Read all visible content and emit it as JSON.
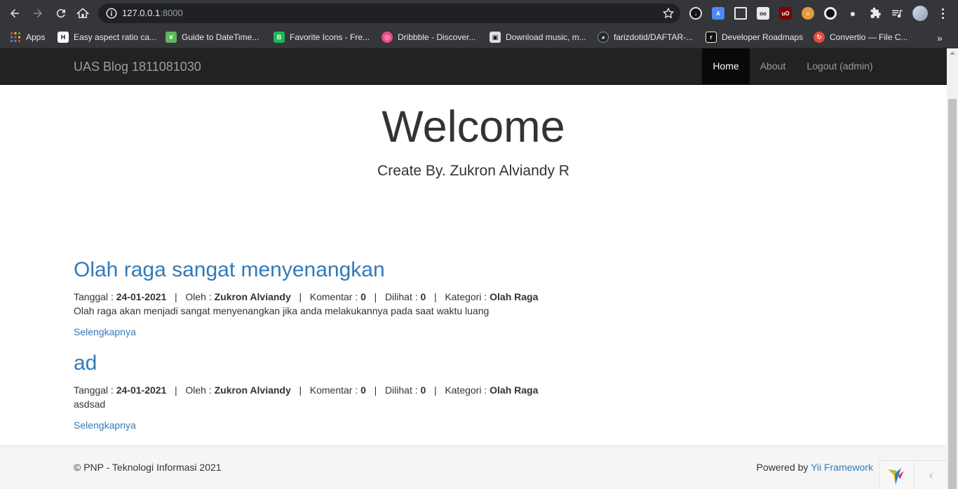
{
  "browser": {
    "url_host": "127.0.0.1",
    "url_port": ":8000",
    "bookmarks": [
      {
        "label": "Apps",
        "icon": "apps-grid-icon",
        "color": "#4285f4"
      },
      {
        "label": "Easy aspect ratio ca...",
        "icon": "aspect-ratio-icon",
        "color": "#ffffff"
      },
      {
        "label": "Guide to DateTime...",
        "icon": "leaf-icon",
        "color": "#5cb85c"
      },
      {
        "label": "Favorite Icons - Fre...",
        "icon": "favorite-icons-icon",
        "color": "#1db954"
      },
      {
        "label": "Dribbble - Discover...",
        "icon": "dribbble-icon",
        "color": "#ea4c89"
      },
      {
        "label": "Download music, m...",
        "icon": "music-download-icon",
        "color": "#dddddd"
      },
      {
        "label": "farizdotid/DAFTAR-...",
        "icon": "github-icon",
        "color": "#24292e"
      },
      {
        "label": "Developer Roadmaps",
        "icon": "roadmap-icon",
        "color": "#111111"
      },
      {
        "label": "Convertio — File C...",
        "icon": "convertio-icon",
        "color": "#e74c3c"
      }
    ]
  },
  "navbar": {
    "brand": "UAS Blog 1811081030",
    "items": [
      {
        "label": "Home",
        "active": true
      },
      {
        "label": "About",
        "active": false
      },
      {
        "label": "Logout (admin)",
        "active": false
      }
    ]
  },
  "jumbotron": {
    "title": "Welcome",
    "subtitle": "Create By. Zukron Alviandy R"
  },
  "posts": [
    {
      "title": "Olah raga sangat menyenangkan",
      "tanggal_label": "Tanggal :",
      "tanggal": "24-01-2021",
      "oleh_label": "Oleh :",
      "oleh": "Zukron Alviandy",
      "komentar_label": "Komentar :",
      "komentar": "0",
      "dilihat_label": "Dilihat :",
      "dilihat": "0",
      "kategori_label": "Kategori :",
      "kategori": "Olah Raga",
      "body": "Olah raga akan menjadi sangat menyenangkan jika anda melakukannya pada saat waktu luang",
      "more": "Selengkapnya"
    },
    {
      "title": "ad",
      "tanggal_label": "Tanggal :",
      "tanggal": "24-01-2021",
      "oleh_label": "Oleh :",
      "oleh": "Zukron Alviandy",
      "komentar_label": "Komentar :",
      "komentar": "0",
      "dilihat_label": "Dilihat :",
      "dilihat": "0",
      "kategori_label": "Kategori :",
      "kategori": "Olah Raga",
      "body": "asdsad",
      "more": "Selengkapnya"
    }
  ],
  "footer": {
    "copyright": "© PNP - Teknologi Informasi 2021",
    "powered_prefix": "Powered by ",
    "powered_link": "Yii Framework"
  },
  "colors": {
    "navbar_bg": "#222222",
    "link": "#337ab7",
    "chrome_bg": "#35363a"
  }
}
